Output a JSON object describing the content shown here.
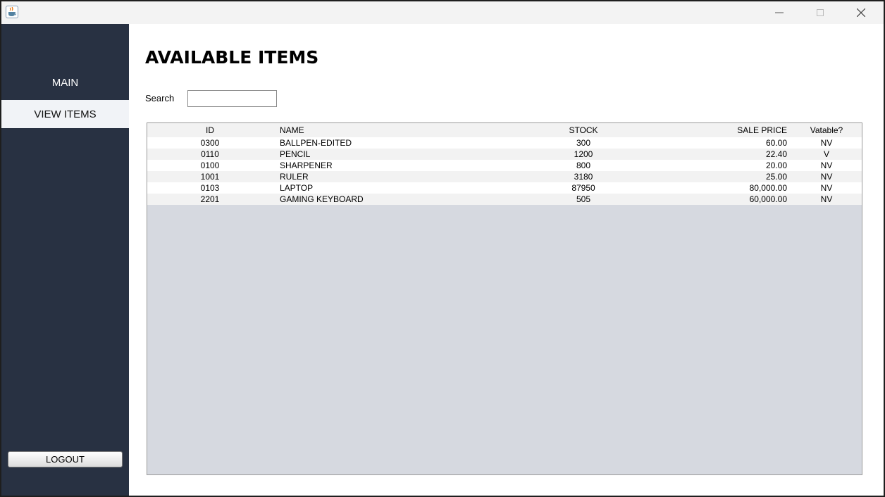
{
  "window": {
    "title": "",
    "controls": {
      "minimize": "minimize-icon",
      "maximize": "maximize-icon",
      "close": "close-icon"
    }
  },
  "sidebar": {
    "items": [
      {
        "label": "MAIN",
        "selected": false
      },
      {
        "label": "VIEW ITEMS",
        "selected": true
      }
    ],
    "logout_label": "LOGOUT",
    "background": "#283142"
  },
  "main": {
    "title": "AVAILABLE ITEMS",
    "search": {
      "label": "Search",
      "value": "",
      "placeholder": ""
    },
    "table": {
      "columns": [
        "ID",
        "NAME",
        "STOCK",
        "SALE PRICE",
        "Vatable?"
      ],
      "rows": [
        [
          "0300",
          "BALLPEN-EDITED",
          "300",
          "60.00",
          "NV"
        ],
        [
          "0110",
          "PENCIL",
          "1200",
          "22.40",
          "V"
        ],
        [
          "0100",
          "SHARPENER",
          "800",
          "20.00",
          "NV"
        ],
        [
          "1001",
          "RULER",
          "3180",
          "25.00",
          "NV"
        ],
        [
          "0103",
          "LAPTOP",
          "87950",
          "80,000.00",
          "NV"
        ],
        [
          "2201",
          "GAMING KEYBOARD",
          "505",
          "60,000.00",
          "NV"
        ]
      ]
    }
  }
}
